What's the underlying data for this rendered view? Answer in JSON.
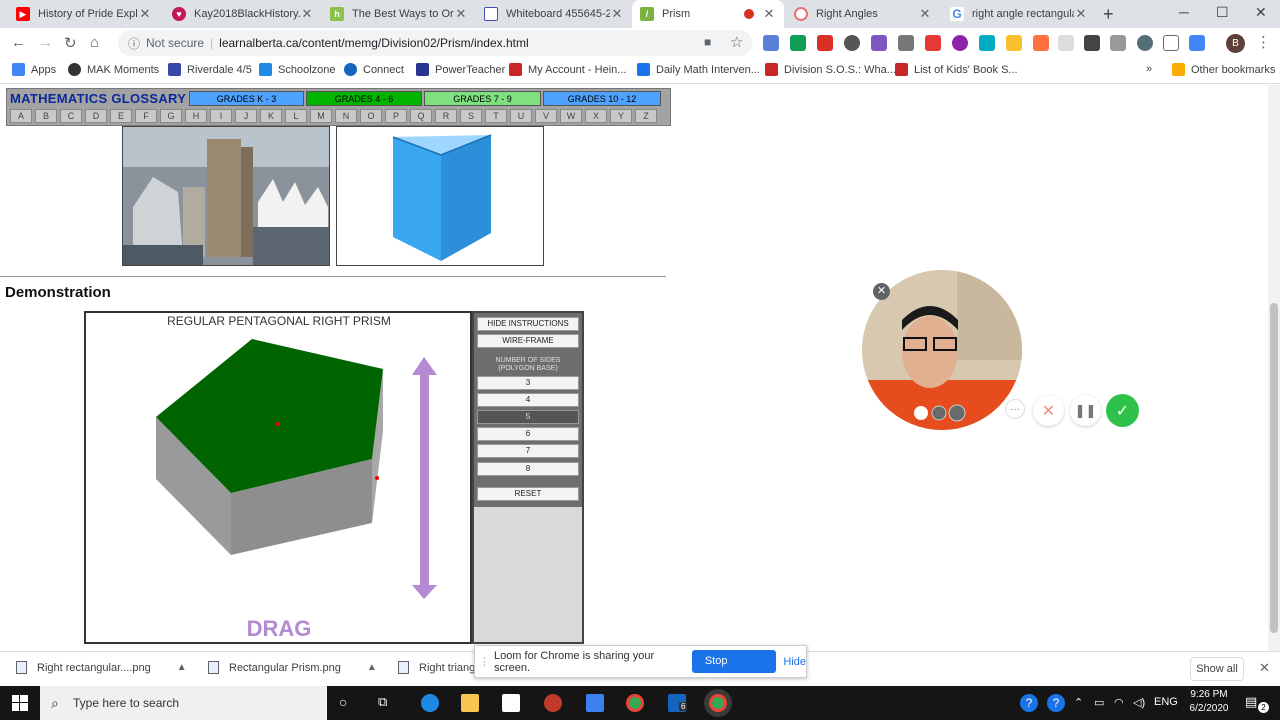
{
  "browser": {
    "tabs": [
      {
        "title": "History of Pride Explain",
        "favicon": "youtube-icon",
        "color": "#ff0000",
        "active": false
      },
      {
        "title": "Kay2018BlackHistory.p",
        "favicon": "heart-icon",
        "color": "#c2185b",
        "active": false
      },
      {
        "title": "The Best Ways to Orga",
        "favicon": "h-icon",
        "color": "#8bc34a",
        "active": false
      },
      {
        "title": "Whiteboard 455645-2",
        "favicon": "whiteboard-icon",
        "color": "#3f51b5",
        "active": false
      },
      {
        "title": "Prism",
        "favicon": "prism-icon",
        "color": "#7cb342",
        "active": true
      },
      {
        "title": "Right Angles",
        "favicon": "target-icon",
        "color": "#e57373",
        "active": false
      },
      {
        "title": "right angle rectangula",
        "favicon": "google-icon",
        "color": "#4285f4",
        "active": false
      }
    ],
    "new_tab_glyph": "+",
    "security_label": "Not secure",
    "url": "learnalberta.ca/content/memg/Division02/Prism/index.html",
    "profile_initial": "B",
    "bookmarks": [
      {
        "label": "Apps",
        "color": "#4285f4"
      },
      {
        "label": "MAK Moments",
        "color": "#333333"
      },
      {
        "label": "Riverdale 4/5",
        "color": "#3949ab"
      },
      {
        "label": "Schoolzone",
        "color": "#1e88e5"
      },
      {
        "label": "Connect",
        "color": "#1565c0"
      },
      {
        "label": "PowerTeacher",
        "color": "#283593"
      },
      {
        "label": "My Account - Hein...",
        "color": "#c62828"
      },
      {
        "label": "Daily Math Interven...",
        "color": "#1a73e8"
      },
      {
        "label": "Division S.O.S.: Wha...",
        "color": "#c62828"
      },
      {
        "label": "List of Kids' Book S...",
        "color": "#c62828"
      }
    ],
    "bookmarks_overflow": "»",
    "other_bookmarks": "Other bookmarks"
  },
  "glossary": {
    "title": "MATHEMATICS GLOSSARY",
    "grades": [
      {
        "label": "GRADES K - 3",
        "color": "#4da3ff"
      },
      {
        "label": "GRADES 4 - 6",
        "color": "#00b400"
      },
      {
        "label": "GRADES 7 - 9",
        "color": "#7ee07e"
      },
      {
        "label": "GRADES 10 - 12",
        "color": "#4da3ff"
      }
    ],
    "letters": [
      "A",
      "B",
      "C",
      "D",
      "E",
      "F",
      "G",
      "H",
      "I",
      "J",
      "K",
      "L",
      "M",
      "N",
      "O",
      "P",
      "Q",
      "R",
      "S",
      "T",
      "U",
      "V",
      "W",
      "X",
      "Y",
      "Z"
    ]
  },
  "demonstration": {
    "heading": "Demonstration",
    "applet_title": "REGULAR PENTAGONAL RIGHT PRISM",
    "drag_label": "DRAG",
    "colors": {
      "top_face": "#006400",
      "side_face": "#8e8e8e",
      "arrow": "#b48ad2"
    },
    "panel": {
      "hide_instructions": "HIDE INSTRUCTIONS",
      "wireframe": "WIRE-FRAME",
      "sides_label_1": "NUMBER OF SIDES",
      "sides_label_2": "(POLYGON BASE)",
      "sides": [
        "3",
        "4",
        "5",
        "6",
        "7",
        "8"
      ],
      "selected_sides": "5",
      "reset": "RESET"
    }
  },
  "loom": {
    "close_glyph": "✕",
    "message": "Loom for Chrome is sharing your screen.",
    "stop_label": "Stop sharing",
    "hide_label": "Hide"
  },
  "downloads": {
    "items": [
      "Right rectangular....png",
      "Rectangular Prism.png",
      "Right triangu"
    ],
    "show_all": "Show all"
  },
  "taskbar": {
    "search_placeholder": "Type here to search",
    "language": "ENG",
    "time": "9:26 PM",
    "date": "6/2/2020",
    "mail_badge": "6",
    "notification_count": "2"
  }
}
